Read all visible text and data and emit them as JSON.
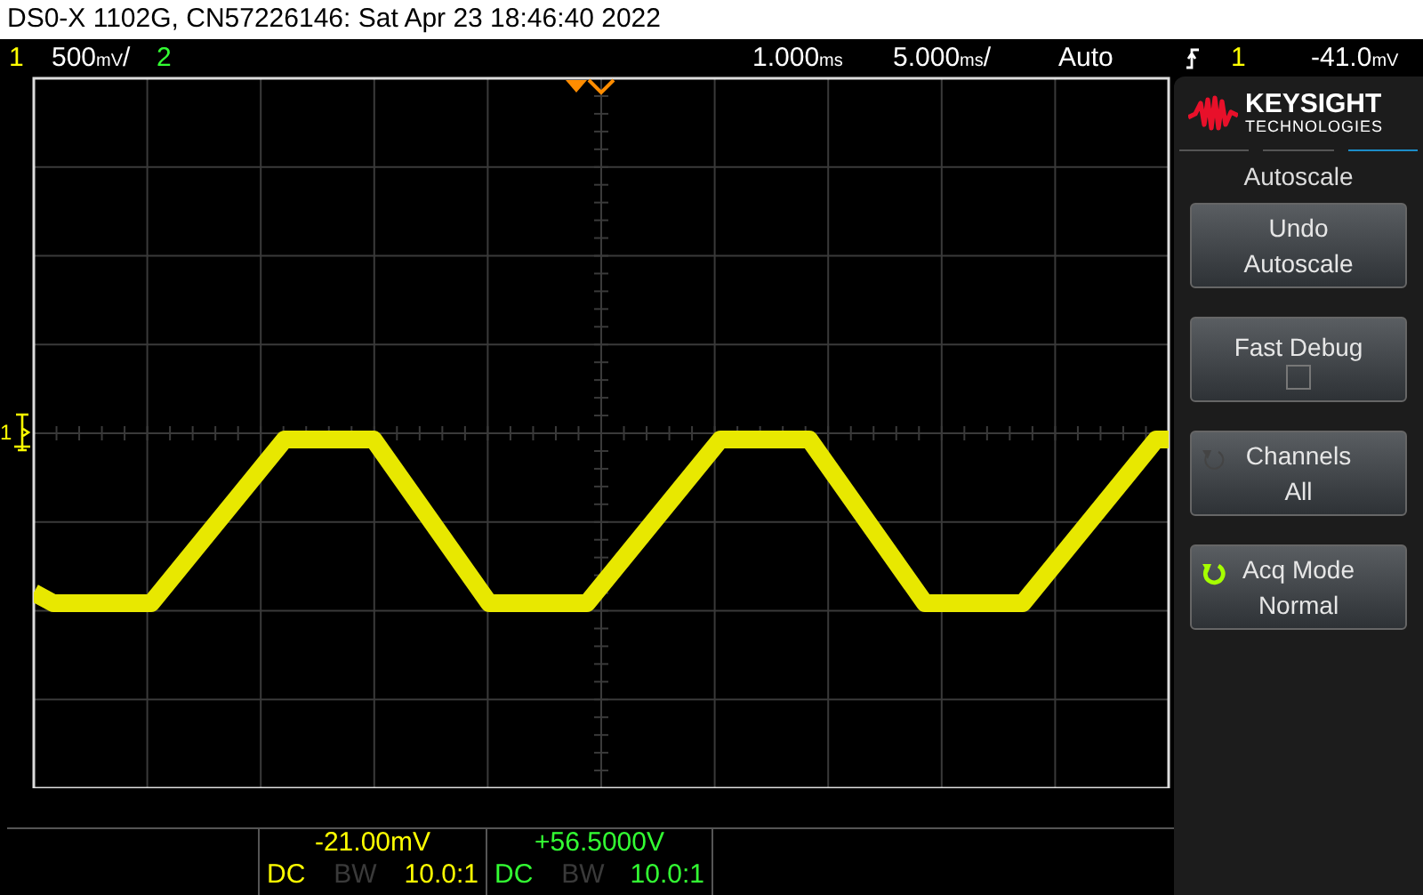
{
  "window": {
    "title": "DS0-X 1102G, CN57226146: Sat Apr 23 18:46:40 2022"
  },
  "top_bar": {
    "channel_1": {
      "label": "1",
      "scale": "500",
      "unit": "mV",
      "suffix": "/"
    },
    "channel_2": {
      "label": "2"
    },
    "delay": {
      "value": "1.000",
      "unit": "ms"
    },
    "timebase": {
      "value": "5.000",
      "unit": "ms",
      "suffix": "/"
    },
    "trigger_mode": "Auto",
    "trigger_source": "1",
    "trigger_level": {
      "value": "-41.0",
      "unit": "mV"
    }
  },
  "display": {
    "ground_marker": "1"
  },
  "side_panel": {
    "logo": {
      "brand": "KEYSIGHT",
      "subtitle": "TECHNOLOGIES"
    },
    "menu_title": "Autoscale",
    "softkeys": [
      {
        "kind": "button",
        "lines": [
          "Undo",
          "Autoscale"
        ]
      },
      {
        "kind": "checkbox",
        "lines": [
          "Fast Debug"
        ],
        "checked": false
      },
      {
        "kind": "cycle",
        "lines": [
          "Channels",
          "All"
        ],
        "enabled": false
      },
      {
        "kind": "cycle",
        "lines": [
          "Acq Mode",
          "Normal"
        ],
        "enabled": true
      }
    ]
  },
  "channel_info": [
    {
      "offset": "-21.00mV",
      "coupling": "DC",
      "bandwidth": "BW",
      "bandwidth_limit": false,
      "probe": "10.0:1",
      "color": "#ffff00"
    },
    {
      "offset": "+56.5000V",
      "coupling": "DC",
      "bandwidth": "BW",
      "bandwidth_limit": false,
      "probe": "10.0:1",
      "color": "#33ff33"
    }
  ]
}
